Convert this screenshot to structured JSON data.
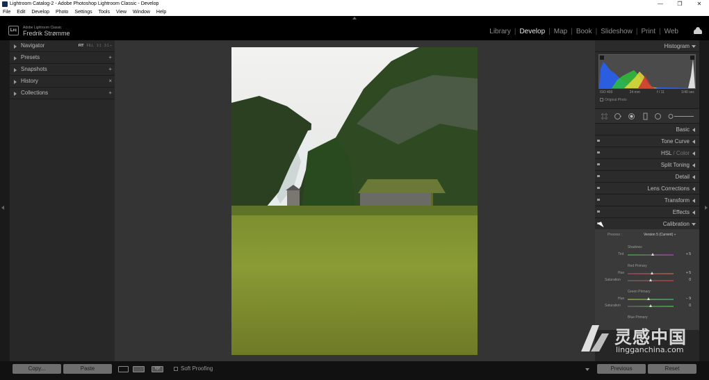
{
  "window": {
    "title": "Lightroom Catalog-2 - Adobe Photoshop Lightroom Classic - Develop",
    "controls": [
      "—",
      "❐",
      "✕"
    ]
  },
  "menu": [
    "File",
    "Edit",
    "Develop",
    "Photo",
    "Settings",
    "Tools",
    "View",
    "Window",
    "Help"
  ],
  "identity": {
    "badge": "Lrc",
    "product": "Adobe Lightroom Classic",
    "user": "Fredrik Strømme"
  },
  "modules": {
    "items": [
      "Library",
      "Develop",
      "Map",
      "Book",
      "Slideshow",
      "Print",
      "Web"
    ],
    "active": "Develop"
  },
  "left_panel": {
    "navigator": {
      "label": "Navigator",
      "options": [
        "FIT",
        "FILL",
        "1:1",
        "3:1 ÷"
      ]
    },
    "presets": {
      "label": "Presets",
      "ctrl": "+"
    },
    "snapshots": {
      "label": "Snapshots",
      "ctrl": "+"
    },
    "history": {
      "label": "History",
      "ctrl": "×"
    },
    "collections": {
      "label": "Collections",
      "ctrl": "+"
    }
  },
  "histogram": {
    "label": "Histogram",
    "iso": "ISO 400",
    "focal": "24 mm",
    "aperture": "f / 11",
    "shutter": "1/40 sec",
    "original_photo": "Original Photo"
  },
  "right_panels": {
    "basic": "Basic",
    "tone_curve": "Tone Curve",
    "hsl": "HSL",
    "color": "Color",
    "split_toning": "Split Toning",
    "detail": "Detail",
    "lens_corrections": "Lens Corrections",
    "transform": "Transform",
    "effects": "Effects",
    "calibration": "Calibration"
  },
  "calibration": {
    "process_label": "Process :",
    "process_value": "Version 5 (Current) ÷",
    "shadows": "Shadows",
    "tint_label": "Tint",
    "tint_value": "+ 5",
    "tint": 0.55,
    "red_primary": "Red Primary",
    "red_hue_label": "Hue",
    "red_hue_value": "+ 5",
    "red_hue": 0.53,
    "red_sat_label": "Saturation",
    "red_sat_value": "0",
    "red_sat": 0.5,
    "green_primary": "Green Primary",
    "green_hue_label": "Hue",
    "green_hue_value": "− 9",
    "green_hue": 0.45,
    "green_sat_label": "Saturation",
    "green_sat_value": "0",
    "green_sat": 0.5,
    "blue_primary": "Blue Primary"
  },
  "bottom": {
    "copy": "Copy...",
    "paste": "Paste",
    "soft_proofing": "Soft Proofing",
    "previous": "Previous",
    "reset": "Reset",
    "yy": "Y|Y"
  },
  "watermark": {
    "cn": "灵感中国",
    "en": "lingganchina.com"
  },
  "colors": {
    "accent_text": "#e6e6e6",
    "panel_bg": "#282828",
    "center_bg": "#343434"
  }
}
